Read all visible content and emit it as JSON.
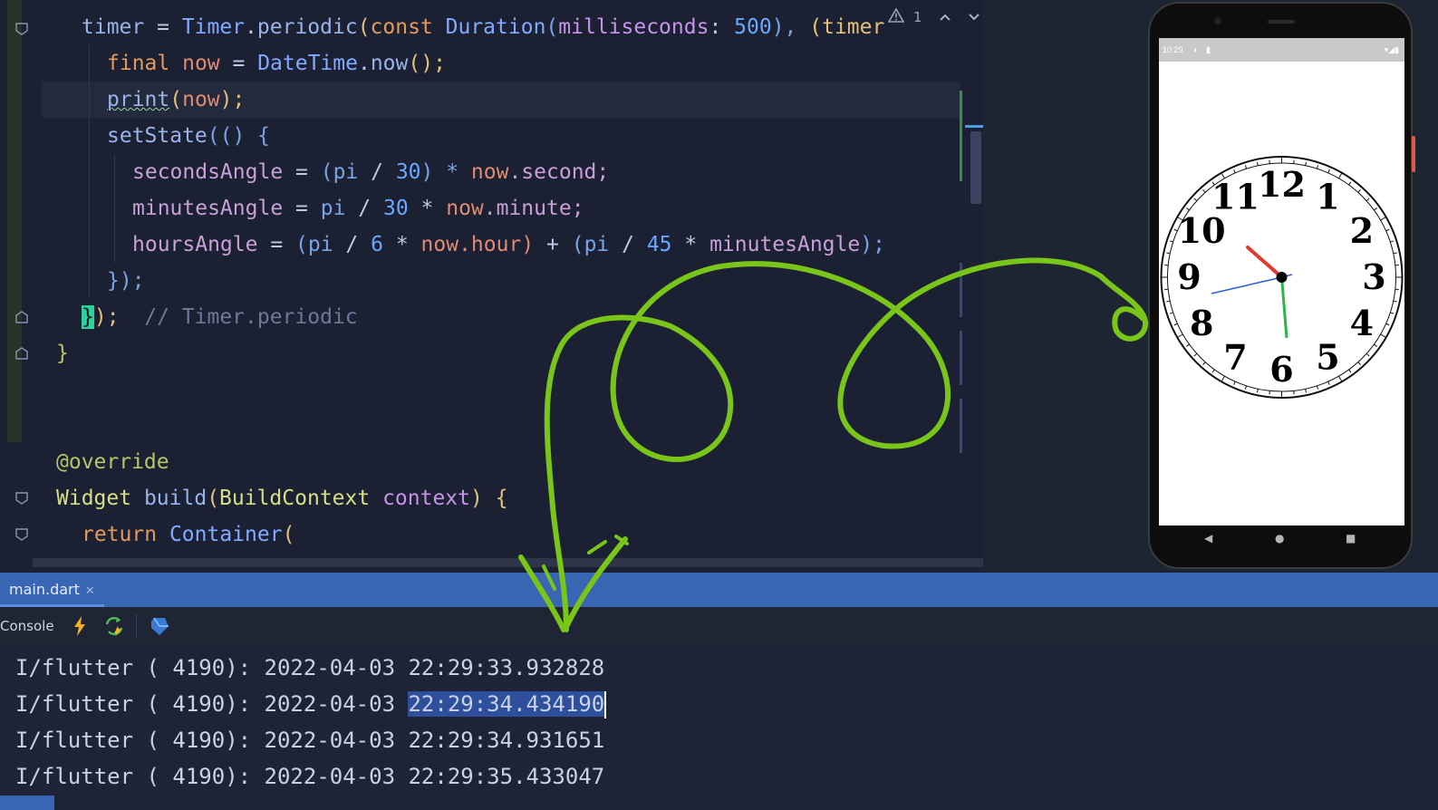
{
  "editor": {
    "lines": {
      "l1": {
        "a": "timer",
        "b": " = ",
        "c": "Timer",
        "d": ".",
        "e": "periodic",
        "f": "(",
        "g": "const ",
        "h": "Duration",
        "i": "(",
        "j": "milliseconds",
        "k": ": ",
        "l": "500",
        "m": "), ",
        "n": "(timer"
      },
      "l2": {
        "a": "final ",
        "b": "now",
        "c": " = ",
        "d": "DateTime",
        "e": ".",
        "f": "now",
        "g": "();"
      },
      "l3": {
        "a": "print",
        "b": "(",
        "c": "now",
        "d": ");"
      },
      "l4": {
        "a": "setState",
        "b": "(() {"
      },
      "l5": {
        "a": "secondsAngle",
        "b": " = ",
        "c": "(pi ",
        "d": "/ ",
        "e": "30",
        "f": ") * ",
        "g": "now",
        "h": ".second;"
      },
      "l6": {
        "a": "minutesAngle",
        "b": " = ",
        "c": "pi ",
        "d": "/ ",
        "e": "30",
        "f": " * ",
        "g": "now",
        "h": ".minute;"
      },
      "l7": {
        "a": "hoursAngle",
        "b": " = ",
        "c": "(pi ",
        "d": "/ ",
        "e": "6",
        "f": " * ",
        "g": "now",
        "h": ".hour) ",
        "i": "+ ",
        "j": "(pi ",
        "k": "/ ",
        "l": "45",
        "m": " * ",
        "n": "minutesAngle",
        "o": ");"
      },
      "l8": {
        "a": "});"
      },
      "l9": {
        "a": "}",
        "b": ");  ",
        "c": "// Timer.periodic"
      },
      "l10": {
        "a": "}"
      },
      "l11": {
        "a": "@override"
      },
      "l12": {
        "a": "Widget ",
        "b": "build",
        "c": "(",
        "d": "BuildContext ",
        "e": "context",
        "f": ") {"
      },
      "l13": {
        "a": "return ",
        "b": "Container",
        "c": "("
      }
    },
    "inspection_count": "1",
    "icons": [
      "warning-icon",
      "chevron-up-icon",
      "chevron-down-icon",
      "fold-icon"
    ]
  },
  "phone": {
    "status_time": "10:29",
    "clock_numbers": [
      "12",
      "1",
      "2",
      "3",
      "4",
      "5",
      "6",
      "7",
      "8",
      "9",
      "10",
      "11"
    ],
    "hand_colors": {
      "hour": "#e23b2e",
      "minute": "#2f5fd0",
      "second": "#2fb34a"
    },
    "nav_icons": [
      "back-icon",
      "home-icon",
      "recents-icon"
    ]
  },
  "bottom_panel": {
    "tab_label": "main.dart",
    "console_label": "Console",
    "toolbar_icons": [
      "hot-reload-icon",
      "hot-restart-icon",
      "dart-devtools-icon"
    ],
    "log": [
      {
        "prefix": "I/flutter ( 4190): 2022-04-03 ",
        "time": "22:29:33.932828"
      },
      {
        "prefix": "I/flutter ( 4190): 2022-04-03 ",
        "time": "22:29:34.434190"
      },
      {
        "prefix": "I/flutter ( 4190): 2022-04-03 ",
        "time": "22:29:34.931651"
      },
      {
        "prefix": "I/flutter ( 4190): 2022-04-03 ",
        "time": "22:29:35.433047"
      }
    ]
  },
  "colors": {
    "annotation": "#7ac51a",
    "tab_accent": "#3866b2",
    "selection": "#2d4f9c"
  }
}
